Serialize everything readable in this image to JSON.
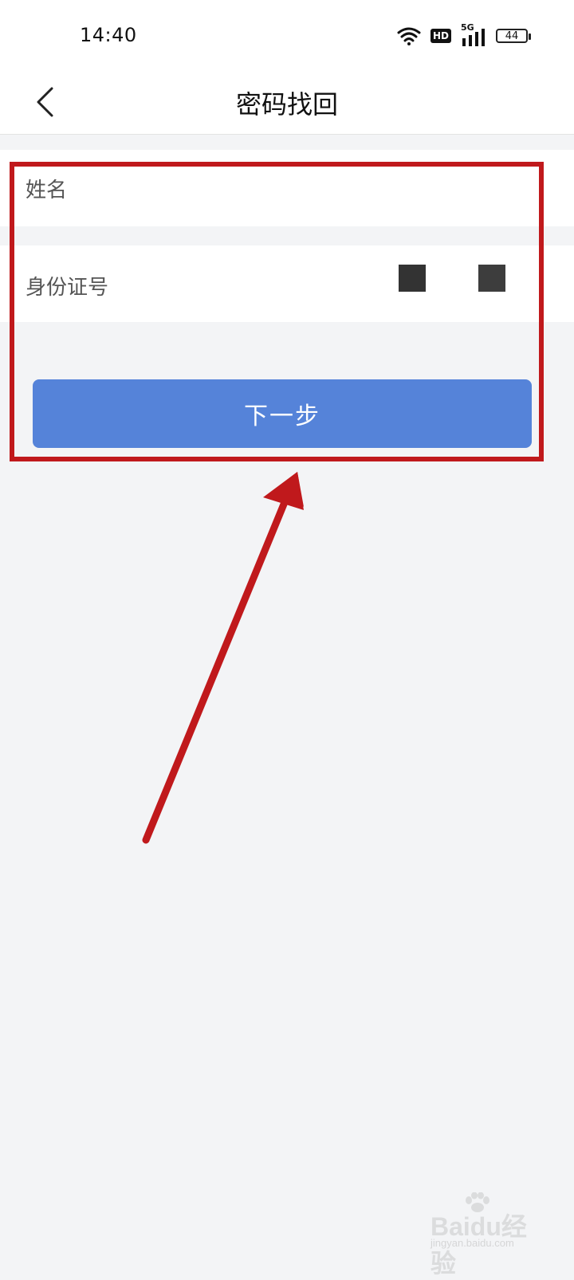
{
  "status_bar": {
    "time": "14:40",
    "hd_label": "HD",
    "network_label": "5G",
    "battery_level": "44"
  },
  "header": {
    "title": "密码找回",
    "back_icon": "chevron-left-icon"
  },
  "form": {
    "name_label": "姓名",
    "name_value": "",
    "id_label": "身份证号",
    "id_value": ""
  },
  "next_button_label": "下一步",
  "colors": {
    "primary_button": "#5583d9",
    "annotation": "#c0191c",
    "page_background": "#f3f4f6"
  },
  "watermark": {
    "brand": "Baidu经验",
    "url": "jingyan.baidu.com"
  }
}
